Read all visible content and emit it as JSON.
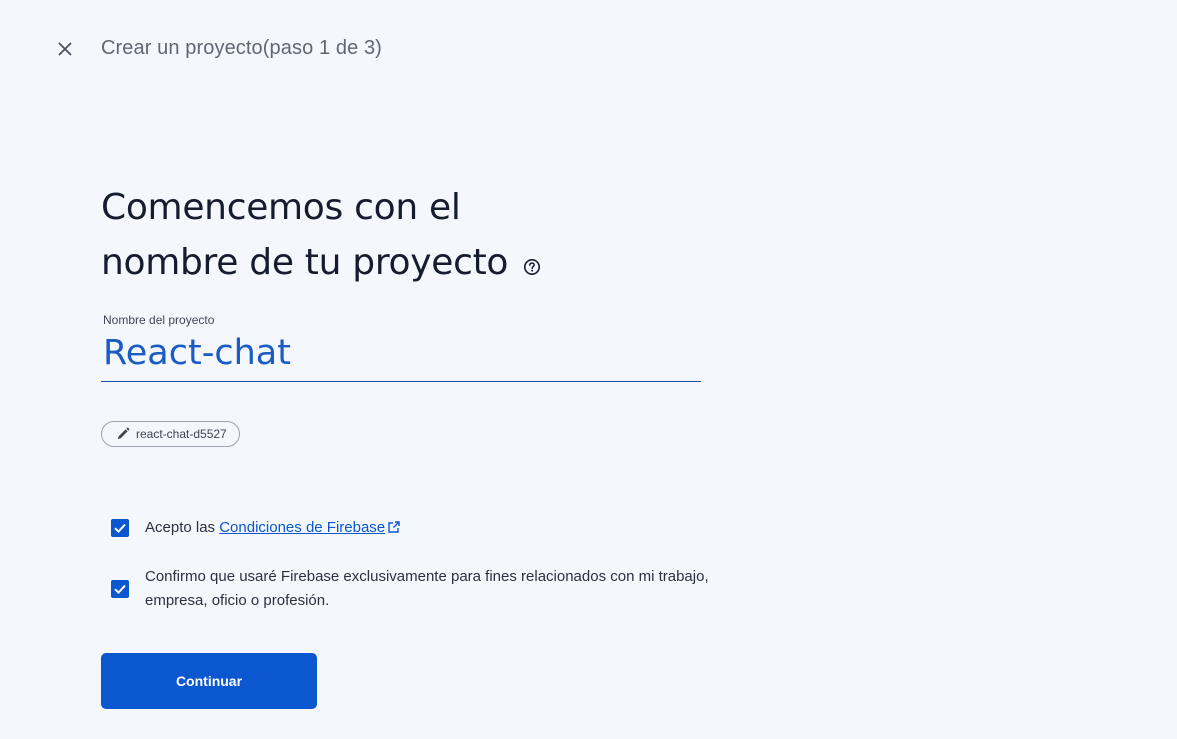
{
  "header": {
    "close_icon": "close-icon",
    "title": "Crear un proyecto(paso 1 de 3)"
  },
  "main": {
    "headline_line1": "Comencemos con el",
    "headline_line2": "nombre de tu proyecto",
    "help_icon": "help-circle-icon",
    "field_label": "Nombre del proyecto",
    "project_name": "React-chat",
    "project_id": "react-chat-d5527",
    "pencil_icon": "pencil-icon"
  },
  "checks": [
    {
      "checked": true,
      "text_prefix": "Acepto las ",
      "link_text": "Condiciones de Firebase",
      "link_icon": "external-link-icon"
    },
    {
      "checked": true,
      "text": "Confirmo que usaré Firebase exclusivamente para fines relacionados con mi trabajo, empresa, oficio o profesión."
    }
  ],
  "actions": {
    "continue_label": "Continuar"
  },
  "colors": {
    "accent": "#0b57d0",
    "background": "#f4f7fc"
  }
}
